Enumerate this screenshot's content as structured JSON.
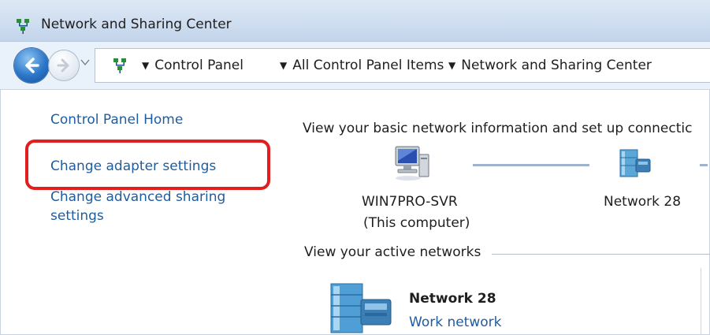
{
  "window": {
    "title": "Network and Sharing Center"
  },
  "address_bar": {
    "crumbs": [
      "Control Panel",
      "All Control Panel Items",
      "Network and Sharing Center"
    ]
  },
  "sidebar": {
    "home": "Control Panel Home",
    "adapter": "Change adapter settings",
    "advanced_line1": "Change advanced sharing",
    "advanced_line2": "settings"
  },
  "main": {
    "heading": "View your basic network information and set up connectic",
    "computer_name": "WIN7PRO-SVR",
    "computer_sub": "(This computer)",
    "network_map_name": "Network  28",
    "active_heading": "View your active networks",
    "active_network_name": "Network  28",
    "active_network_type": "Work network"
  },
  "colors": {
    "link": "#1f5c9e",
    "highlight": "#e31e1e",
    "title_bar": "#cfdef0"
  }
}
